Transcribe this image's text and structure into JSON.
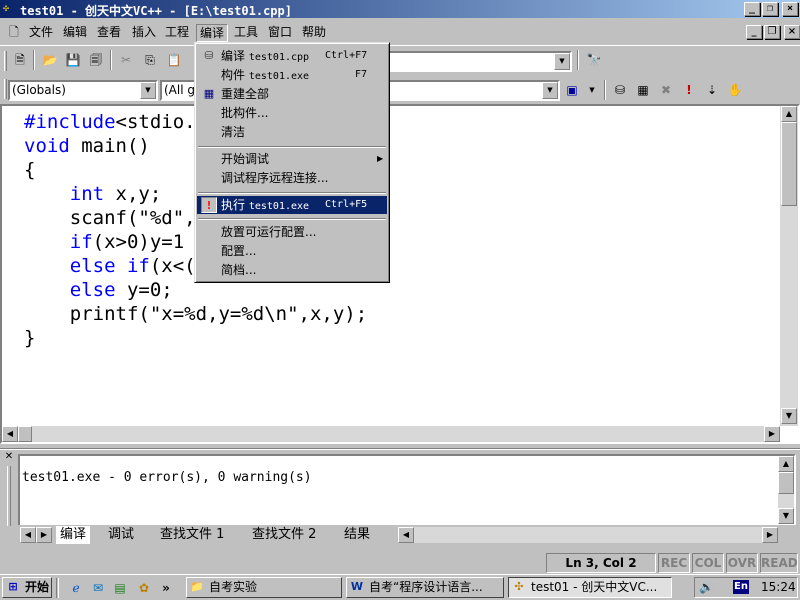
{
  "window": {
    "title": "test01 - 创天中文VC++ - [E:\\test01.cpp]"
  },
  "menubar": [
    "文件",
    "编译",
    "查看",
    "插入",
    "工程",
    "编译",
    "工具",
    "窗口",
    "帮助"
  ],
  "menus_visible": {
    "file": "文件",
    "edit": "编辑",
    "view": "查看",
    "insert": "插入",
    "project": "工程",
    "build": "编译",
    "tools": "工具",
    "window": "窗口",
    "help": "帮助"
  },
  "toolbar": {
    "combo_find_value": "",
    "globals_combo": "(Globals)",
    "members_combo": "(All g",
    "func_combo": ""
  },
  "editor": {
    "lines": [
      {
        "kw": "#include",
        "rest": "<stdio."
      },
      {
        "kw": "void",
        "rest": " main()"
      },
      {
        "kw": "",
        "rest": "{"
      },
      {
        "kw": "    int",
        "rest": " x,y;"
      },
      {
        "kw": "",
        "rest": "    scanf(\"%d\","
      },
      {
        "kw": "    if",
        "rest": "(x>0)y=1"
      },
      {
        "kw": "    else if",
        "rest": "(x<("
      },
      {
        "kw": "    else",
        "rest": " y=0;"
      },
      {
        "kw": "",
        "rest": "    printf(\"x=%d,y=%d\\n\",x,y);"
      },
      {
        "kw": "",
        "rest": "}"
      }
    ]
  },
  "build_menu": {
    "items": [
      {
        "label": "编译",
        "target": "test01.cpp",
        "shortcut": "Ctrl+F7",
        "icon": "compile-icon"
      },
      {
        "label": "构件",
        "target": "test01.exe",
        "shortcut": "F7",
        "icon": ""
      },
      {
        "label": "重建全部",
        "target": "",
        "shortcut": "",
        "icon": "rebuild-icon"
      },
      {
        "label": "批构件...",
        "target": "",
        "shortcut": "",
        "icon": ""
      },
      {
        "label": "清洁",
        "target": "",
        "shortcut": "",
        "icon": ""
      },
      {
        "label": "开始调试",
        "target": "",
        "shortcut": "",
        "icon": "",
        "submenu": true
      },
      {
        "label": "调试程序远程连接...",
        "target": "",
        "shortcut": "",
        "icon": ""
      },
      {
        "label": "执行",
        "target": "test01.exe",
        "shortcut": "Ctrl+F5",
        "icon": "execute-icon",
        "selected": true
      },
      {
        "label": "放置可运行配置...",
        "target": "",
        "shortcut": "",
        "icon": ""
      },
      {
        "label": "配置...",
        "target": "",
        "shortcut": "",
        "icon": ""
      },
      {
        "label": "简档...",
        "target": "",
        "shortcut": "",
        "icon": ""
      }
    ]
  },
  "output": {
    "message": "test01.exe - 0 error(s), 0 warning(s)",
    "tabs": [
      "编译",
      "调试",
      "查找文件 1",
      "查找文件 2",
      "结果"
    ]
  },
  "status": {
    "position": "Ln 3, Col 2",
    "rec": "REC",
    "col": "COL",
    "ovr": "OVR",
    "read": "READ"
  },
  "taskbar": {
    "start": "开始",
    "tasks": [
      "自考实验",
      "自考“程序设计语言...",
      "test01 - 创天中文VC..."
    ],
    "lang": "En",
    "time": "15:24"
  }
}
